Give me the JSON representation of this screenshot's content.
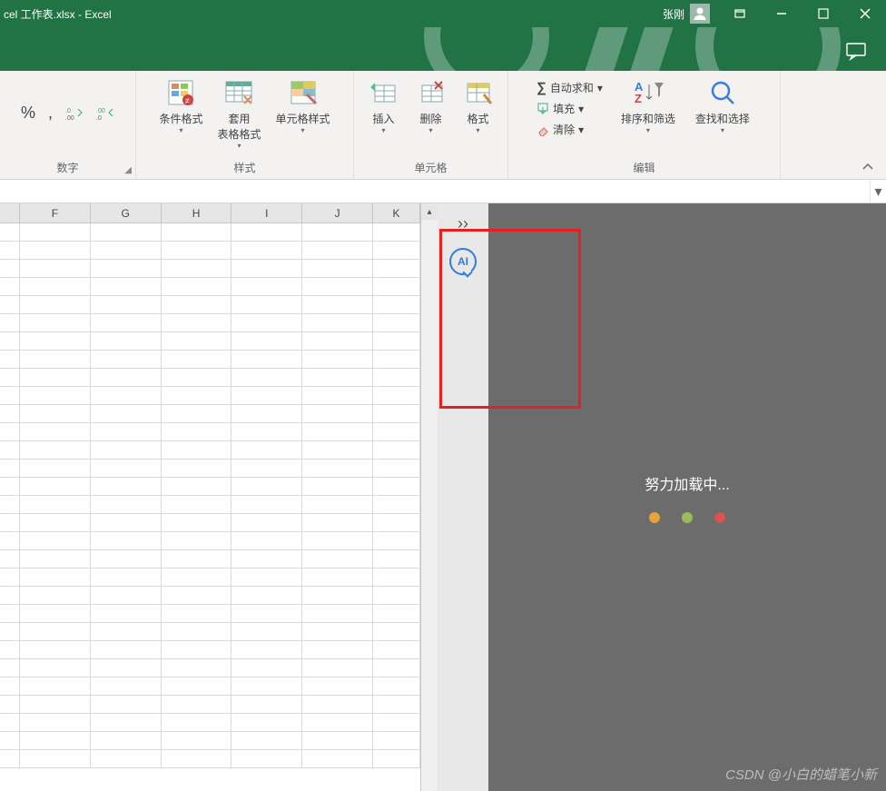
{
  "title": "cel 工作表.xlsx - Excel",
  "user": {
    "name": "张刚"
  },
  "ribbon": {
    "groups": {
      "number": {
        "label": "数字",
        "percent": "%",
        "comma": ",",
        "inc_dec": ".00",
        "dec_inc": ".0"
      },
      "styles": {
        "label": "样式",
        "cond_fmt": "条件格式",
        "table_fmt": "套用\n表格格式",
        "cell_fmt": "单元格样式"
      },
      "cells": {
        "label": "单元格",
        "insert": "插入",
        "delete": "删除",
        "format": "格式"
      },
      "editing": {
        "label": "编辑",
        "autosum": "自动求和",
        "fill": "填充",
        "clear": "清除",
        "sort": "排序和筛选",
        "find": "查找和选择"
      }
    }
  },
  "columns": [
    "F",
    "G",
    "H",
    "I",
    "J",
    "K"
  ],
  "side": {
    "ai_label": "AI"
  },
  "loading": {
    "text": "努力加载中..."
  },
  "watermark": "CSDN @小白的蜡笔小新"
}
